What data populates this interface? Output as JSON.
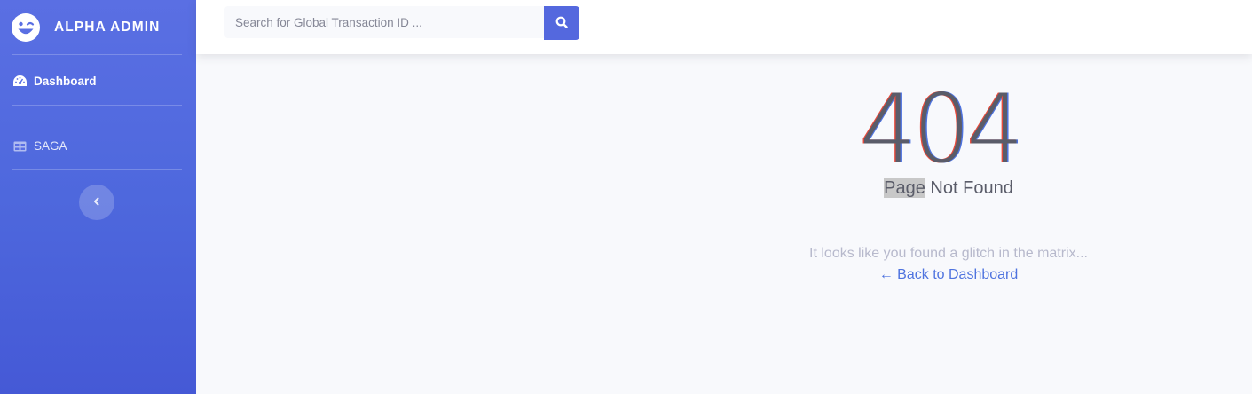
{
  "sidebar": {
    "brand_icon": "laughing-wink-icon",
    "brand_name": "ALPHA ADMIN",
    "items": [
      {
        "label": "Dashboard",
        "icon": "tachometer-icon",
        "active": true
      },
      {
        "label": "SAGA",
        "icon": "table-icon",
        "active": false
      }
    ],
    "toggle_icon": "chevron-left-icon"
  },
  "topbar": {
    "search_placeholder": "Search for Global Transaction ID ...",
    "search_value": "",
    "search_icon": "search-icon"
  },
  "error": {
    "code": "404",
    "message_highlight": "Page",
    "message_rest": " Not Found",
    "glitch": "It looks like you found a glitch in the matrix...",
    "back_link": "← Back to Dashboard"
  },
  "colors": {
    "sidebar_top": "#5a6fe3",
    "sidebar_bottom": "#4559d6",
    "accent": "#4e73df",
    "text_dark": "#5a5c69",
    "text_muted": "#b7b9cc"
  }
}
